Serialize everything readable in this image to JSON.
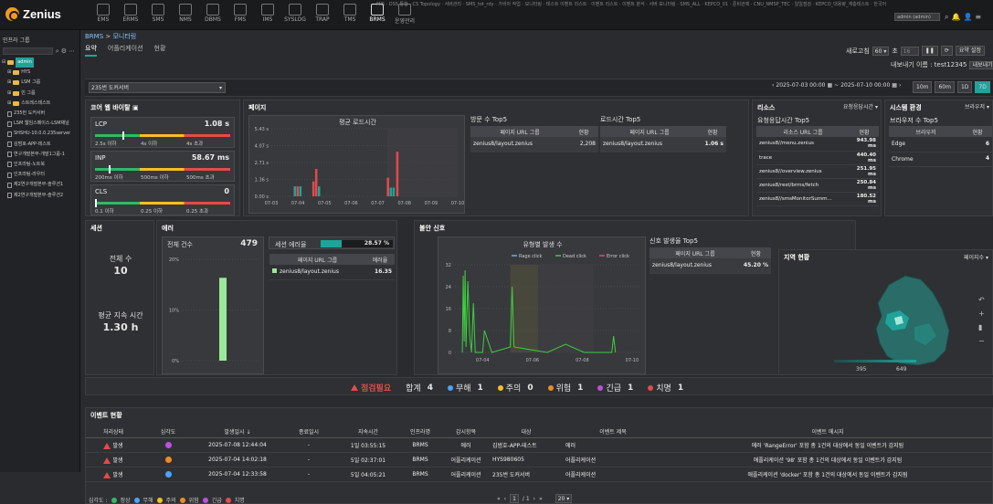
{
  "app": {
    "brand": "Zenius"
  },
  "topnav": [
    {
      "label": "EMS"
    },
    {
      "label": "ERMS"
    },
    {
      "label": "SMS"
    },
    {
      "label": "NMS"
    },
    {
      "label": "DBMS"
    },
    {
      "label": "FMS"
    },
    {
      "label": "IMS"
    },
    {
      "label": "SYSLOG"
    },
    {
      "label": "TRAP"
    },
    {
      "label": "TMS"
    },
    {
      "label": "BRMS"
    },
    {
      "label": "운영관리"
    }
  ],
  "topmenu": "MIS · DSS 통합 · CS Topology · 서버관리 · SMS_tot_rdy · 가비아 작업 · 모니터링 · 테스트 이벤트 리스트 · 이벤트 리스트 · 이벤트 분석 · 서버 모니터링 · SMS_ALL · KEPCO_01 · 준비관제 · CNU_NMSP_TEC · 일일점검 · KEPCO_대용량_계층테스트 · 한국어 · 로그아웃",
  "user": {
    "name": "admin (admin)"
  },
  "sidebar": {
    "title": "인프라 그룹",
    "items": [
      {
        "label": "admin",
        "type": "root",
        "level": 0,
        "selected": true
      },
      {
        "label": "HYS",
        "type": "folder",
        "level": 1
      },
      {
        "label": "LSM 그룹",
        "type": "folder",
        "level": 1
      },
      {
        "label": "빈 그룹",
        "type": "folder",
        "level": 1
      },
      {
        "label": "스트레스테스트",
        "type": "folder",
        "level": 1
      },
      {
        "label": "235번 도커서버",
        "type": "server",
        "level": 1
      },
      {
        "label": "LSM 웹임스페이스-LSM채널",
        "type": "server",
        "level": 1
      },
      {
        "label": "SHSHU-10.0.0.235server",
        "type": "server",
        "level": 1
      },
      {
        "label": "김범호-APP-테스트",
        "type": "server",
        "level": 1
      },
      {
        "label": "연구개발본부-개발1그룹-1",
        "type": "server",
        "level": 1
      },
      {
        "label": "인프라팀-노트북",
        "type": "server",
        "level": 1
      },
      {
        "label": "인프라팀-라우터",
        "type": "server",
        "level": 1
      },
      {
        "label": "제2연구개발본부-솔루션1",
        "type": "server",
        "level": 1
      },
      {
        "label": "제2연구개발본부-솔루션2",
        "type": "server",
        "level": 1
      }
    ]
  },
  "breadcrumb": {
    "parent": "BRMS",
    "current": "모니터링"
  },
  "tabs": [
    {
      "label": "요약",
      "active": true
    },
    {
      "label": "어플리케이션",
      "active": false
    },
    {
      "label": "현황",
      "active": false
    }
  ],
  "refresh": {
    "label": "새로고침",
    "value": "60",
    "unit": "초",
    "count": "16",
    "report_btn": "요약 설정"
  },
  "export": {
    "label": "내보내기 이름 : test12345",
    "btn": "내보내기"
  },
  "filter": {
    "server": "235번 도커서버",
    "date_from": "2025-07-03 00:00",
    "date_to": "2025-07-10 00:00",
    "ranges": [
      {
        "label": "10m",
        "active": false
      },
      {
        "label": "60m",
        "active": false
      },
      {
        "label": "1D",
        "active": false
      },
      {
        "label": "7D",
        "active": true
      }
    ]
  },
  "core_vitals": {
    "title": "코어 웹 바이탈",
    "metrics": [
      {
        "name": "LCP",
        "value": "1.08 s",
        "marker": 0.2,
        "ticks": [
          "2.5s 이하",
          "4s 이하",
          "4s 초과"
        ]
      },
      {
        "name": "INP",
        "value": "58.67 ms",
        "marker": 0.1,
        "ticks": [
          "200ms 이하",
          "500ms 이하",
          "500ms 초과"
        ]
      },
      {
        "name": "CLS",
        "value": "0",
        "marker": 0.0,
        "ticks": [
          "0.1 이하",
          "0.25 이하",
          "0.25 초과"
        ]
      }
    ]
  },
  "page": {
    "title": "페이지",
    "load_chart_title": "평균 로드시간",
    "visit_top5": {
      "title": "방문 수 Top5",
      "col1": "페이지 URL 그룹",
      "col2": "현황",
      "rows": [
        {
          "url": "zenius8/layout.zenius",
          "value": "2,208"
        }
      ]
    },
    "load_top5": {
      "title": "로드시간 Top5",
      "col1": "페이지 URL 그룹",
      "col2": "현황",
      "rows": [
        {
          "url": "zenius8/layout.zenius",
          "value": "1.06 s"
        }
      ]
    }
  },
  "resource": {
    "title": "리소스",
    "select": "요청응답시간",
    "sub": "요청응답시간 Top5",
    "col1": "리소스 URL 그룹",
    "col2": "현황",
    "rows": [
      {
        "url": "zenius8//menu.zenius",
        "value": "943.98 ms"
      },
      {
        "url": "trace",
        "value": "440.40 ms"
      },
      {
        "url": "zenius8//overview.zenius",
        "value": "251.95 ms"
      },
      {
        "url": "zenius8/rest/brms/fetch",
        "value": "250.84 ms"
      },
      {
        "url": "zenius8//smsMonitorSumm...",
        "value": "180.52 ms"
      }
    ]
  },
  "sysenv": {
    "title": "시스템 환경",
    "select": "브라우저",
    "sub": "브라우저 수 Top5",
    "col1": "브라우저",
    "col2": "현황",
    "rows": [
      {
        "name": "Edge",
        "value": "6"
      },
      {
        "name": "Chrome",
        "value": "4"
      }
    ]
  },
  "session": {
    "title": "세션",
    "total_label": "전체 수",
    "total": "10",
    "avg_label": "평균 지속 시간",
    "avg": "1.30 h"
  },
  "error": {
    "title": "에러",
    "total_label": "전체 건수",
    "total": "479",
    "session_rate_label": "세션 에러율",
    "session_rate": "28.57 %",
    "session_rate_value": 28.57,
    "col1": "페이지 URL 그룹",
    "col2": "에러율",
    "rows": [
      {
        "url": "zenius8/layout.zenius",
        "value": "16.35"
      }
    ]
  },
  "anxiety": {
    "title": "불안 신호",
    "chart_title": "유형별 발생 수",
    "top5_title": "신호 발생율 Top5",
    "col1": "페이지 URL 그룹",
    "col2": "현황",
    "rows": [
      {
        "url": "zenius8/layout.zenius",
        "value": "45.20 %"
      }
    ]
  },
  "region": {
    "title": "지역 현황",
    "select": "페이지수",
    "legend_min": "395",
    "legend_max": "649"
  },
  "summary": {
    "alert_label": "점검필요",
    "items": [
      {
        "label": "합계",
        "value": "4",
        "color": ""
      },
      {
        "label": "무해",
        "value": "1",
        "color": "#4aa3ff"
      },
      {
        "label": "주의",
        "value": "0",
        "color": "#f5c023"
      },
      {
        "label": "위험",
        "value": "1",
        "color": "#f08a24"
      },
      {
        "label": "긴급",
        "value": "1",
        "color": "#c04ee0"
      },
      {
        "label": "치명",
        "value": "1",
        "color": "#e34b4b"
      }
    ]
  },
  "events": {
    "title": "이벤트 현황",
    "columns": [
      "처리상태",
      "심각도",
      "발생일시 ↓",
      "종료일시",
      "지속시간",
      "인프라명",
      "감시항목",
      "대상",
      "이벤트 제목",
      "이벤트 메시지"
    ],
    "rows": [
      {
        "status": "발생",
        "severity": "#c04ee0",
        "start": "2025-07-08 12:44:04",
        "end": "-",
        "duration": "1일 03:55:15",
        "infra": "BRMS",
        "item": "에러",
        "target": "김범호-APP-테스트",
        "subject": "에러",
        "message": "에러 'RangeError' 포함 총 1건의 대상에서 동일 이벤트가 감지됨"
      },
      {
        "status": "발생",
        "severity": "#f08a24",
        "start": "2025-07-04 14:02:18",
        "end": "-",
        "duration": "5일 02:37:01",
        "infra": "BRMS",
        "item": "어플리케이션",
        "target": "HYS980605",
        "subject": "어플리케이션",
        "message": "애플리케이션 '98' 포함 총 1건의 대상에서 동일 이벤트가 감지됨"
      },
      {
        "status": "발생",
        "severity": "#4aa3ff",
        "start": "2025-07-04 12:33:58",
        "end": "-",
        "duration": "5일 04:05:21",
        "infra": "BRMS",
        "item": "어플리케이션",
        "target": "235번 도커서버",
        "subject": "어플리케이션",
        "message": "애플리케이션 'docker' 포함 총 1건의 대상에서 동일 이벤트가 감지됨"
      }
    ],
    "footer_legend_label": "심각도 :",
    "footer_legend": [
      {
        "label": "정상",
        "color": "#33b866"
      },
      {
        "label": "무해",
        "color": "#4aa3ff"
      },
      {
        "label": "주의",
        "color": "#f5c023"
      },
      {
        "label": "위험",
        "color": "#f08a24"
      },
      {
        "label": "긴급",
        "color": "#c04ee0"
      },
      {
        "label": "치명",
        "color": "#e34b4b"
      }
    ],
    "page": "1",
    "pages": "/ 1",
    "per_page": "20"
  },
  "chart_data": [
    {
      "type": "bar",
      "title": "평균 로드시간",
      "categories": [
        "07-03",
        "07-04",
        "07-05",
        "07-06",
        "07-07",
        "07-08",
        "07-09",
        "07-10"
      ],
      "yticks": [
        "5.43 s",
        "4.07 s",
        "2.71 s",
        "1.36 s",
        "0.00 s"
      ],
      "ylim": [
        0,
        5.43
      ],
      "bars": [
        {
          "x": 0.12,
          "v": 0.8,
          "c": "#1fa39a"
        },
        {
          "x": 0.135,
          "v": 0.8,
          "c": "#e34b4b"
        },
        {
          "x": 0.15,
          "v": 0.8,
          "c": "#1fa39a"
        },
        {
          "x": 0.22,
          "v": 1.2,
          "c": "#e34b4b"
        },
        {
          "x": 0.235,
          "v": 2.2,
          "c": "#e34b4b"
        },
        {
          "x": 0.25,
          "v": 0.8,
          "c": "#1fa39a"
        },
        {
          "x": 0.62,
          "v": 1.5,
          "c": "#e34b4b"
        },
        {
          "x": 0.635,
          "v": 0.7,
          "c": "#1fa39a"
        },
        {
          "x": 0.65,
          "v": 0.7,
          "c": "#1fa39a"
        },
        {
          "x": 0.67,
          "v": 3.6,
          "c": "#e34b4b"
        }
      ]
    },
    {
      "type": "bar",
      "title": "에러",
      "yticks": [
        "20%",
        "10%",
        "0%"
      ],
      "ylim": [
        0,
        20
      ],
      "values": [
        16.35
      ]
    },
    {
      "type": "line",
      "title": "유형별 발생 수",
      "categories": [
        "07-04",
        "07-06",
        "07-08",
        "07-10"
      ],
      "yticks": [
        "32",
        "24",
        "16",
        "8",
        "0"
      ],
      "ylim": [
        0,
        32
      ],
      "series": [
        {
          "name": "Rage click",
          "color": "#5ab4e6"
        },
        {
          "name": "Dead click",
          "color": "#3ecf3e"
        },
        {
          "name": "Error click",
          "color": "#e34b7a"
        }
      ]
    }
  ]
}
